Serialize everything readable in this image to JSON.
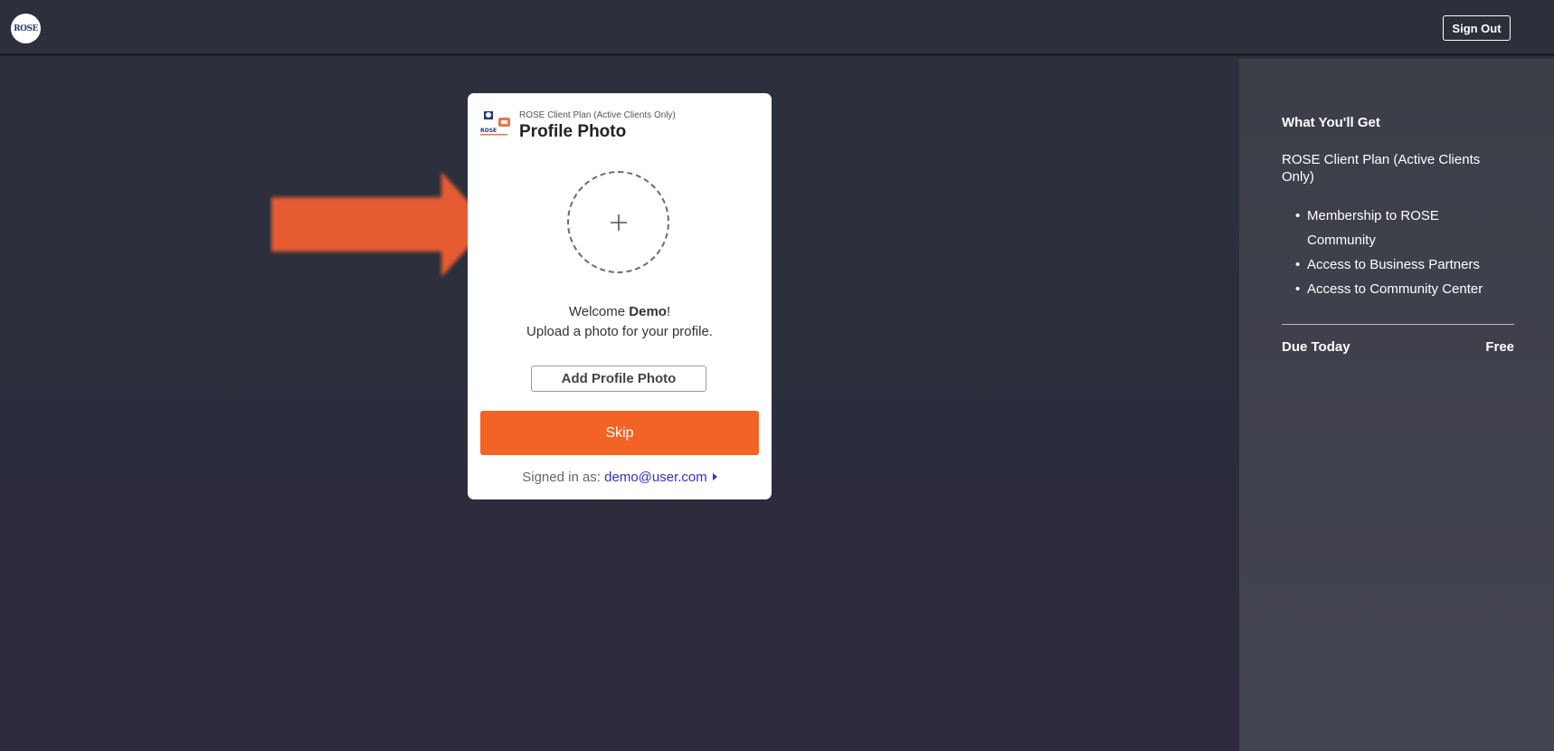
{
  "header": {
    "logo_text": "ROSE",
    "signout_label": "Sign Out"
  },
  "card": {
    "subtitle": "ROSE Client Plan (Active Clients Only)",
    "title": "Profile Photo",
    "welcome_prefix": "Welcome ",
    "user_name": "Demo",
    "welcome_suffix": "!",
    "upload_text": "Upload a photo for your profile.",
    "add_photo_label": "Add Profile Photo",
    "skip_label": "Skip",
    "signed_in_prefix": "Signed in as: ",
    "email": "demo@user.com",
    "upload_icon": "plus-icon"
  },
  "sidebar": {
    "heading": "What You'll Get",
    "plan_name": "ROSE Client Plan (Active Clients Only)",
    "items": [
      {
        "label": "Membership to ROSE Community"
      },
      {
        "label": "Access to Business Partners"
      },
      {
        "label": "Access to Community Center"
      }
    ],
    "due_label": "Due Today",
    "due_value": "Free"
  },
  "colors": {
    "accent": "#f26325",
    "arrow": "#e65c30",
    "link": "#2f2fd6"
  }
}
